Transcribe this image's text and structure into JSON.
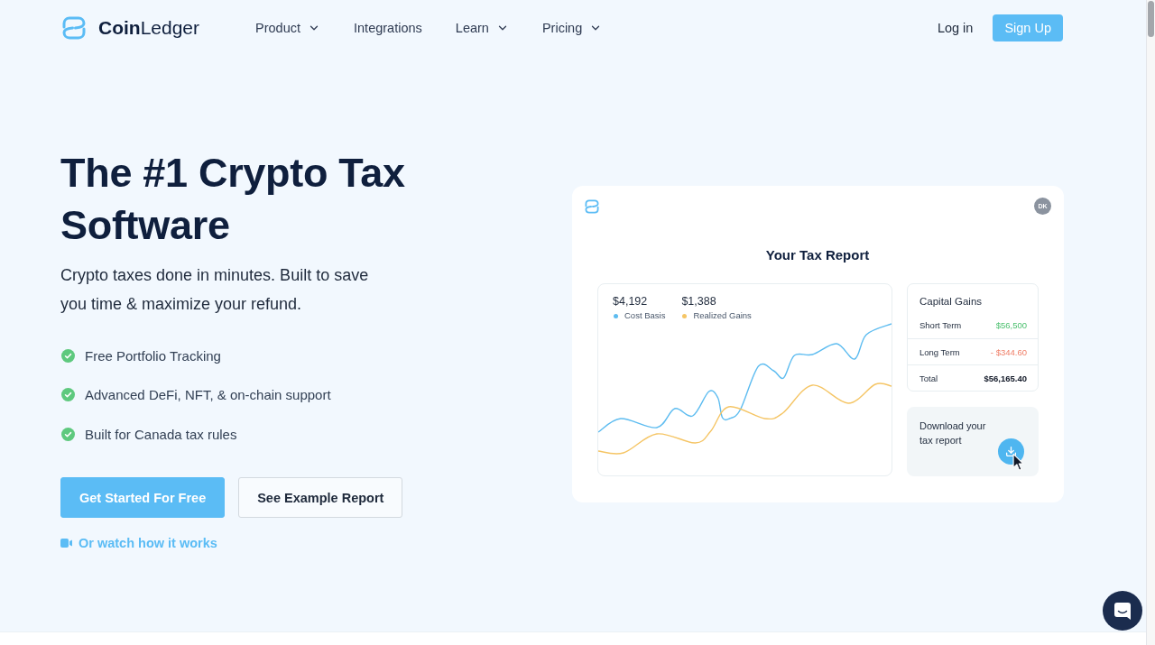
{
  "nav": {
    "logo": "**Coin**Ledger",
    "items": [
      {
        "label": "Product",
        "dropdown": true
      },
      {
        "label": "Integrations",
        "dropdown": false
      },
      {
        "label": "Learn",
        "dropdown": true
      },
      {
        "label": "Pricing",
        "dropdown": true
      }
    ],
    "login": "Log in",
    "signup": "Sign Up"
  },
  "hero": {
    "title": "The #1 Crypto Tax Software",
    "subtitle": "Crypto taxes done in minutes. Built to save you time & maximize your refund.",
    "features": [
      "Free Portfolio Tracking",
      "Advanced DeFi, NFT, & on-chain support",
      "Built for Canada tax rules"
    ],
    "buttons": [
      {
        "label": "Get Started For Free",
        "kind": "primary"
      },
      {
        "label": "See Example Report",
        "kind": "secondary"
      }
    ],
    "video_link": "Or watch how it works"
  },
  "report": {
    "avatar": "DK",
    "title": "Your Tax Report",
    "series": [
      {
        "value": "$4,192",
        "name": "Cost Basis",
        "color": "#5dbcf0"
      },
      {
        "value": "$1,388",
        "name": "Realized Gains",
        "color": "#f5c565"
      }
    ],
    "capital_gains": {
      "title": "Capital Gains",
      "rows": [
        {
          "label": "Short Term",
          "value": "$56,500",
          "kind": "gain"
        },
        {
          "label": "Long Term",
          "value": "- $344.60",
          "kind": "loss"
        },
        {
          "label": "Total",
          "value": "$56,165.40",
          "kind": "total"
        }
      ]
    },
    "download": "Download your tax report"
  }
}
